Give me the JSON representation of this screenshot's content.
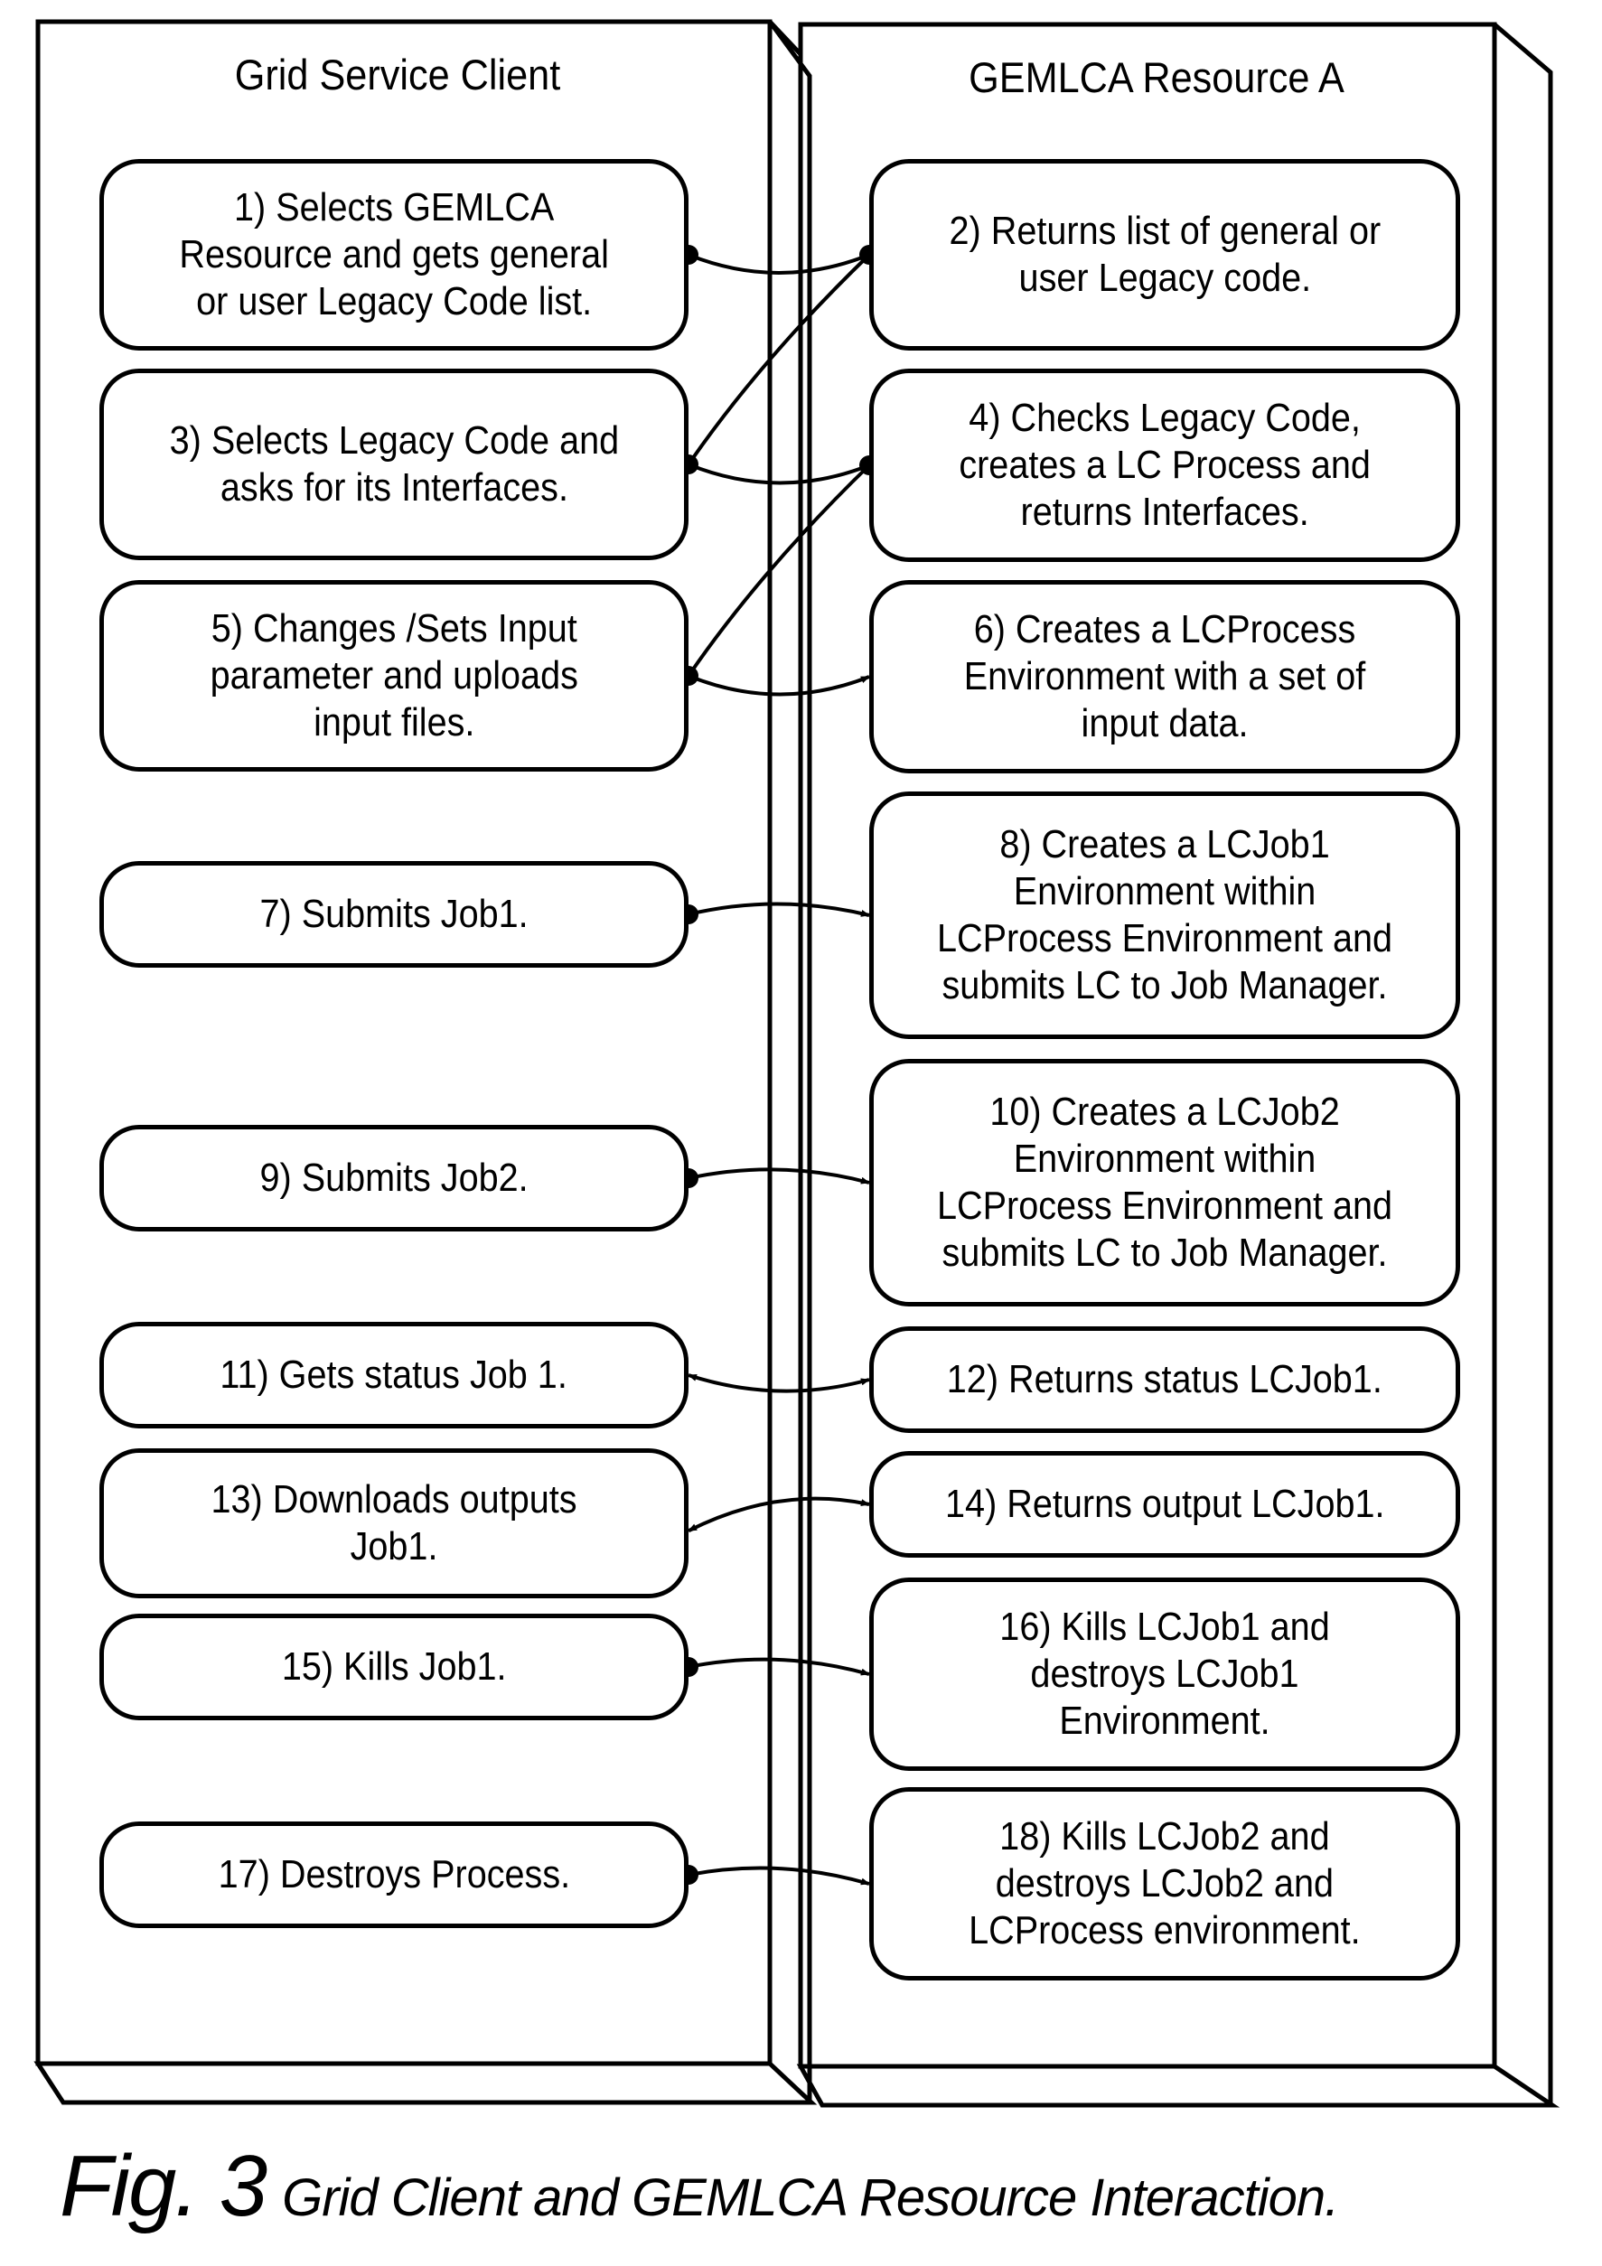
{
  "lanes": {
    "client": {
      "title": "Grid Service Client"
    },
    "resource": {
      "title": "GEMLCA Resource A"
    }
  },
  "steps": [
    {
      "id": 1,
      "lane": "client",
      "text": "1) Selects GEMLCA\nResource and gets general\nor user Legacy Code list."
    },
    {
      "id": 2,
      "lane": "resource",
      "text": "2) Returns list of general or\nuser Legacy code."
    },
    {
      "id": 3,
      "lane": "client",
      "text": "3) Selects Legacy Code and\nasks for its Interfaces."
    },
    {
      "id": 4,
      "lane": "resource",
      "text": "4) Checks Legacy Code,\ncreates a LC Process and\nreturns Interfaces."
    },
    {
      "id": 5,
      "lane": "client",
      "text": "5) Changes /Sets Input\nparameter and uploads\ninput files."
    },
    {
      "id": 6,
      "lane": "resource",
      "text": "6) Creates a LCProcess\nEnvironment with a set of\ninput data."
    },
    {
      "id": 7,
      "lane": "client",
      "text": "7) Submits Job1."
    },
    {
      "id": 8,
      "lane": "resource",
      "text": "8) Creates a LCJob1\nEnvironment within\nLCProcess Environment and\nsubmits LC to Job Manager."
    },
    {
      "id": 9,
      "lane": "client",
      "text": "9) Submits Job2."
    },
    {
      "id": 10,
      "lane": "resource",
      "text": "10) Creates a LCJob2\nEnvironment within\nLCProcess Environment and\nsubmits LC to Job Manager."
    },
    {
      "id": 11,
      "lane": "client",
      "text": "11) Gets status Job 1."
    },
    {
      "id": 12,
      "lane": "resource",
      "text": "12) Returns status LCJob1."
    },
    {
      "id": 13,
      "lane": "client",
      "text": "13) Downloads outputs\nJob1."
    },
    {
      "id": 14,
      "lane": "resource",
      "text": "14) Returns output LCJob1."
    },
    {
      "id": 15,
      "lane": "client",
      "text": "15) Kills Job1."
    },
    {
      "id": 16,
      "lane": "resource",
      "text": "16) Kills LCJob1 and\ndestroys LCJob1\nEnvironment."
    },
    {
      "id": 17,
      "lane": "client",
      "text": "17) Destroys Process."
    },
    {
      "id": 18,
      "lane": "resource",
      "text": "18) Kills LCJob2 and\ndestroys LCJob2 and\nLCProcess environment."
    }
  ],
  "connections": [
    {
      "from": 1,
      "to": 2,
      "style": "dot-to-arrow"
    },
    {
      "from": 2,
      "to": 3,
      "style": "dot-to-arrow"
    },
    {
      "from": 3,
      "to": 4,
      "style": "dot-to-arrow"
    },
    {
      "from": 4,
      "to": 5,
      "style": "dot-to-arrow"
    },
    {
      "from": 5,
      "to": 6,
      "style": "dot-to-arrow"
    },
    {
      "from": 7,
      "to": 8,
      "style": "dot-to-arrow"
    },
    {
      "from": 9,
      "to": 10,
      "style": "dot-to-arrow"
    },
    {
      "from": 11,
      "to": 12,
      "style": "double-arrow"
    },
    {
      "from": 13,
      "to": 14,
      "style": "double-arrow"
    },
    {
      "from": 15,
      "to": 16,
      "style": "dot-to-arrow"
    },
    {
      "from": 17,
      "to": 18,
      "style": "dot-to-arrow"
    }
  ],
  "caption": {
    "figure": "Fig. 3",
    "text": "Grid Client and GEMLCA Resource Interaction."
  }
}
